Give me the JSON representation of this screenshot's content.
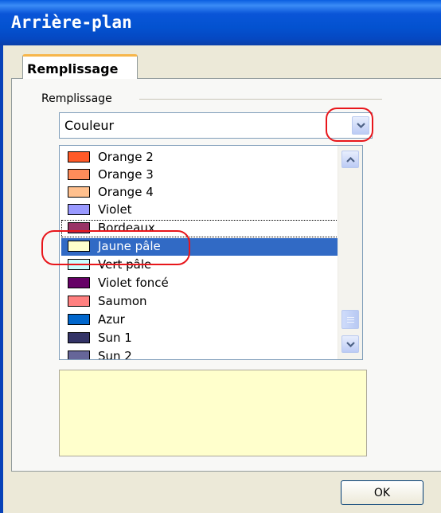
{
  "window": {
    "title": "Arrière-plan"
  },
  "tabs": [
    {
      "label": "Remplissage",
      "active": true
    }
  ],
  "fill_group": {
    "label": "Remplissage",
    "combo": {
      "value": "Couleur"
    }
  },
  "colors": [
    {
      "label": "Orange 2",
      "color": "#ff5a28"
    },
    {
      "label": "Orange 3",
      "color": "#ff8c5a"
    },
    {
      "label": "Orange 4",
      "color": "#ffc08e"
    },
    {
      "label": "Violet",
      "color": "#9999ff"
    },
    {
      "label": "Bordeaux",
      "color": "#993366"
    },
    {
      "label": "Jaune pâle",
      "color": "#ffffcc"
    },
    {
      "label": "Vert pâle",
      "color": "#ccffff"
    },
    {
      "label": "Violet foncé",
      "color": "#660066"
    },
    {
      "label": "Saumon",
      "color": "#ff8080"
    },
    {
      "label": "Azur",
      "color": "#0066cc"
    },
    {
      "label": "Sun 1",
      "color": "#333366"
    },
    {
      "label": "Sun 2",
      "color": "#666699"
    }
  ],
  "selected_color": "Jaune pâle",
  "preview": {
    "color": "#ffffcc"
  },
  "buttons": {
    "ok": "OK"
  },
  "theme": {
    "title_bar": "#0a55d8",
    "selection": "#316ac5",
    "tab_accent": "#f7b64a",
    "highlight_ring": "#e8161b"
  }
}
